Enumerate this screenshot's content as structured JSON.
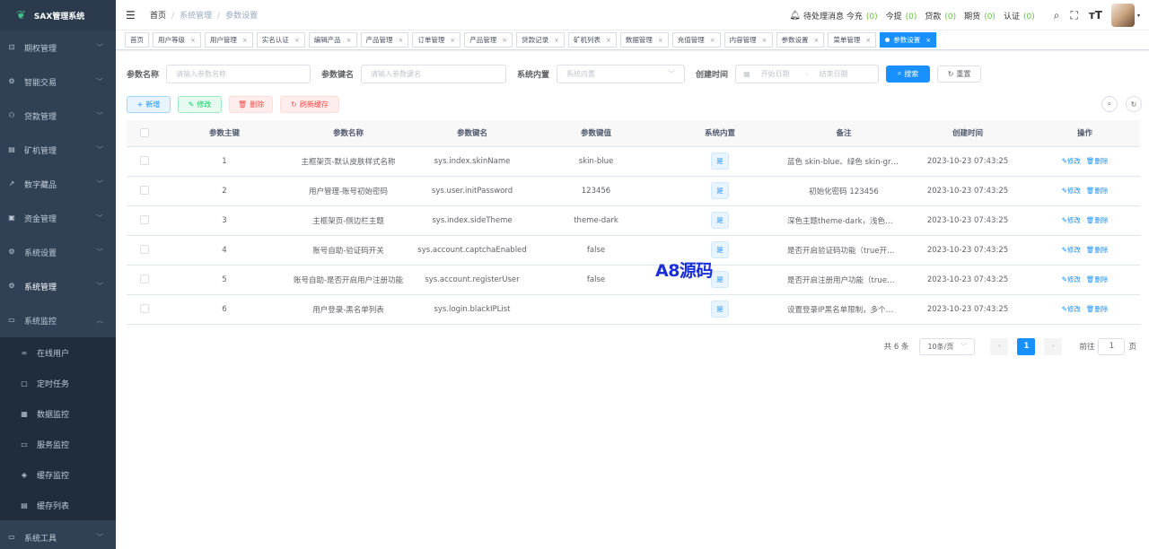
{
  "app": {
    "name": "SAX管理系统"
  },
  "sidebar": {
    "items": [
      {
        "label": "期权管理",
        "icon": "chart-icon"
      },
      {
        "label": "智能交易",
        "icon": "gear-small-icon"
      },
      {
        "label": "贷款管理",
        "icon": "user-group-icon"
      },
      {
        "label": "矿机管理",
        "icon": "server-icon"
      },
      {
        "label": "数字藏品",
        "icon": "trend-icon"
      },
      {
        "label": "资金管理",
        "icon": "wallet-icon"
      },
      {
        "label": "系统设置",
        "icon": "gear-icon"
      },
      {
        "label": "系统管理",
        "icon": "gear-icon"
      },
      {
        "label": "系统监控",
        "icon": "monitor-icon"
      }
    ],
    "sub_items": [
      {
        "label": "在线用户",
        "icon": "online-icon"
      },
      {
        "label": "定时任务",
        "icon": "clock-icon"
      },
      {
        "label": "数据监控",
        "icon": "data-icon"
      },
      {
        "label": "服务监控",
        "icon": "server-monitor-icon"
      },
      {
        "label": "缓存监控",
        "icon": "cache-icon"
      },
      {
        "label": "缓存列表",
        "icon": "list-icon"
      }
    ],
    "bottom_item": {
      "label": "系统工具",
      "icon": "tool-icon"
    }
  },
  "header": {
    "breadcrumb": [
      "首页",
      "系统管理",
      "参数设置"
    ],
    "notice": {
      "prefix": "待处理消息",
      "items": [
        {
          "label": "今充",
          "count": "(0)"
        },
        {
          "label": "今提",
          "count": "(0)"
        },
        {
          "label": "贷款",
          "count": "(0)"
        },
        {
          "label": "期货",
          "count": "(0)"
        },
        {
          "label": "认证",
          "count": "(0)"
        }
      ]
    }
  },
  "tags": [
    "首页",
    "用户等级",
    "用户管理",
    "实名认证",
    "编辑产品",
    "产品管理",
    "订单管理",
    "产品管理",
    "贷款记录",
    "矿机列表",
    "数据管理",
    "充值管理",
    "内容管理",
    "参数设置",
    "菜单管理"
  ],
  "active_tag": "参数设置",
  "search": {
    "name_label": "参数名称",
    "name_placeholder": "请输入参数名称",
    "key_label": "参数键名",
    "key_placeholder": "请输入参数键名",
    "builtin_label": "系统内置",
    "builtin_placeholder": "系统内置",
    "time_label": "创建时间",
    "start_placeholder": "开始日期",
    "date_sep": "-",
    "end_placeholder": "结束日期",
    "search_btn": "搜索",
    "reset_btn": "重置"
  },
  "actions": {
    "add": "新增",
    "edit": "修改",
    "delete": "删除",
    "refresh": "刷新缓存"
  },
  "table": {
    "columns": [
      "参数主键",
      "参数名称",
      "参数键名",
      "参数键值",
      "系统内置",
      "备注",
      "创建时间",
      "操作"
    ],
    "rows": [
      {
        "id": "1",
        "name": "主框架页-默认皮肤样式名称",
        "key": "sys.index.skinName",
        "value": "skin-blue",
        "builtin": "是",
        "remark": "蓝色 skin-blue、绿色 skin-green、紫色 skin-purple",
        "time": "2023-10-23 07:43:25"
      },
      {
        "id": "2",
        "name": "用户管理-账号初始密码",
        "key": "sys.user.initPassword",
        "value": "123456",
        "builtin": "是",
        "remark": "初始化密码 123456",
        "time": "2023-10-23 07:43:25"
      },
      {
        "id": "3",
        "name": "主框架页-侧边栏主题",
        "key": "sys.index.sideTheme",
        "value": "theme-dark",
        "builtin": "是",
        "remark": "深色主题theme-dark，浅色主题theme-light",
        "time": "2023-10-23 07:43:25"
      },
      {
        "id": "4",
        "name": "账号自助-验证码开关",
        "key": "sys.account.captchaEnabled",
        "value": "false",
        "builtin": "是",
        "remark": "是否开启验证码功能（true开启，false关闭）",
        "time": "2023-10-23 07:43:25"
      },
      {
        "id": "5",
        "name": "账号自助-是否开启用户注册功能",
        "key": "sys.account.registerUser",
        "value": "false",
        "builtin": "是",
        "remark": "是否开启注册用户功能（true开启，false关闭）",
        "time": "2023-10-23 07:43:25"
      },
      {
        "id": "6",
        "name": "用户登录-黑名单列表",
        "key": "sys.login.blackIPList",
        "value": "",
        "builtin": "是",
        "remark": "设置登录IP黑名单限制，多个匹配项以;分隔",
        "time": "2023-10-23 07:43:25"
      }
    ],
    "op_edit": "修改",
    "op_delete": "删除"
  },
  "pager": {
    "total": "共 6 条",
    "page_size": "10条/页",
    "current": "1",
    "goto_label": "前往",
    "goto_value": "1",
    "page_unit": "页"
  },
  "watermark": "A8源码"
}
